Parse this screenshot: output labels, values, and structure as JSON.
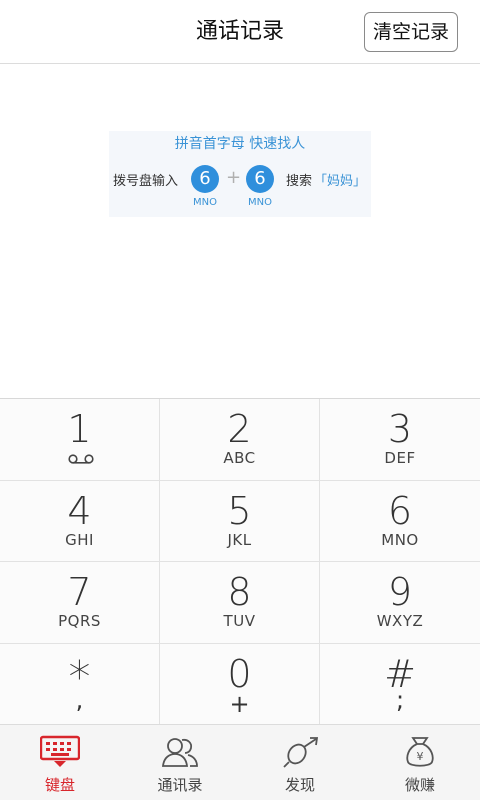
{
  "header": {
    "title": "通话记录",
    "clear_label": "清空记录"
  },
  "tip": {
    "headline": "拼音首字母 快速找人",
    "prefix": "拨号盘输入",
    "digit1": "6",
    "plus": "+",
    "digit2": "6",
    "search": "搜索",
    "quote": "「妈妈」",
    "letters1": "MNO",
    "letters2": "MNO"
  },
  "keypad": [
    {
      "digit": "1",
      "sub": "voicemail-icon"
    },
    {
      "digit": "2",
      "sub": "ABC"
    },
    {
      "digit": "3",
      "sub": "DEF"
    },
    {
      "digit": "4",
      "sub": "GHI"
    },
    {
      "digit": "5",
      "sub": "JKL"
    },
    {
      "digit": "6",
      "sub": "MNO"
    },
    {
      "digit": "7",
      "sub": "PQRS"
    },
    {
      "digit": "8",
      "sub": "TUV"
    },
    {
      "digit": "9",
      "sub": "WXYZ"
    },
    {
      "digit": "*",
      "sub": ","
    },
    {
      "digit": "0",
      "sub": "+"
    },
    {
      "digit": "#",
      "sub": ";"
    }
  ],
  "tabs": [
    {
      "label": "键盘",
      "icon": "keyboard-icon",
      "active": true
    },
    {
      "label": "通讯录",
      "icon": "contacts-icon",
      "active": false
    },
    {
      "label": "发现",
      "icon": "discover-icon",
      "active": false
    },
    {
      "label": "微赚",
      "icon": "money-bag-icon",
      "active": false
    }
  ],
  "colors": {
    "accent": "#d8262c",
    "tip_blue": "#3a93d6",
    "bubble": "#2f8fdc"
  }
}
